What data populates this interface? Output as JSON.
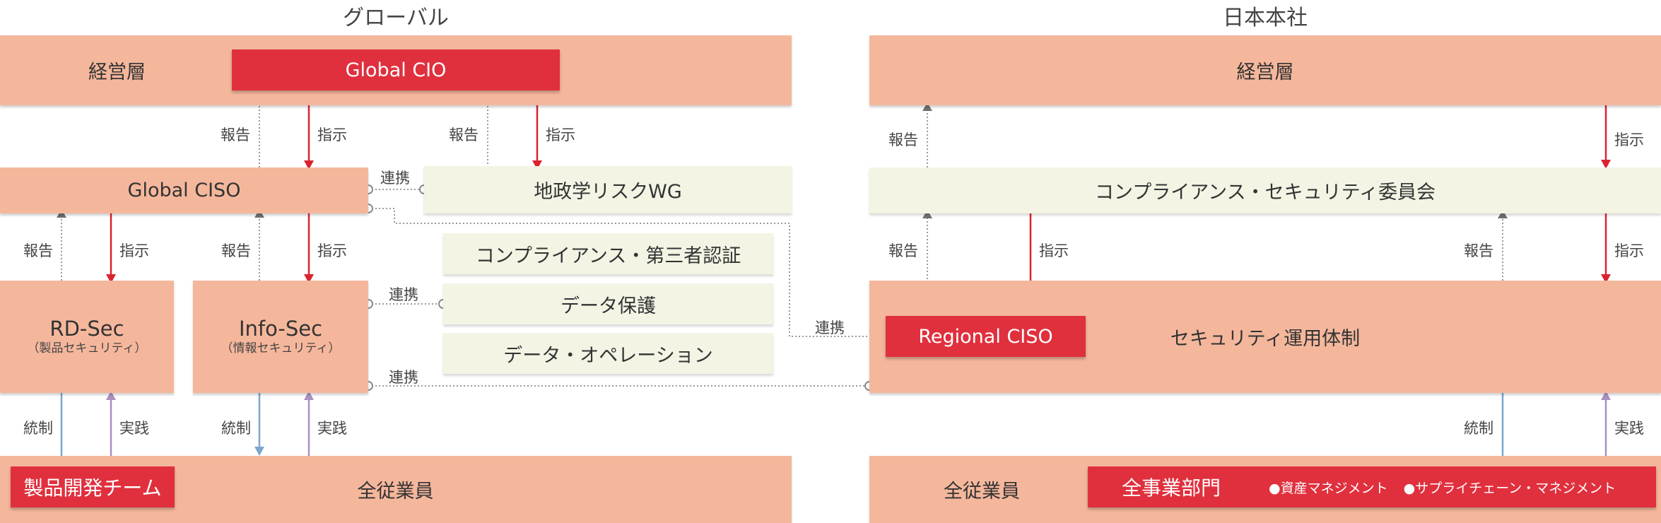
{
  "headers": {
    "global": "グローバル",
    "japan": "日本本社"
  },
  "global": {
    "mgmt": "経営層",
    "cio": "Global CIO",
    "ciso": "Global CISO",
    "geo_wg": "地政学リスクWG",
    "compliance": "コンプライアンス・第三者認証",
    "data_protection": "データ保護",
    "data_ops": "データ・オペレーション",
    "rdsec": {
      "title": "RD-Sec",
      "sub": "（製品セキュリティ）"
    },
    "infosec": {
      "title": "Info-Sec",
      "sub": "（情報セキュリティ）"
    },
    "employees": "全従業員",
    "product_team": "製品開発チーム"
  },
  "japan": {
    "mgmt": "経営層",
    "committee": "コンプライアンス・セキュリティ委員会",
    "regional_ciso": "Regional CISO",
    "ops": "セキュリティ運用体制",
    "employees": "全従業員",
    "all_divisions": "全事業部門",
    "bullet1": "●資産マネジメント",
    "bullet2": "●サプライチェーン・マネジメント"
  },
  "labels": {
    "report": "報告",
    "instruct": "指示",
    "link": "連携",
    "govern": "統制",
    "practice": "実践"
  },
  "colors": {
    "salmon": "#f5b79c",
    "cream": "#f3f4e4",
    "red": "#e0303e",
    "arrow_red": "#d9242f",
    "arrow_gray": "#707070",
    "arrow_blue": "#7ba7cf",
    "arrow_purple": "#a890c0"
  }
}
